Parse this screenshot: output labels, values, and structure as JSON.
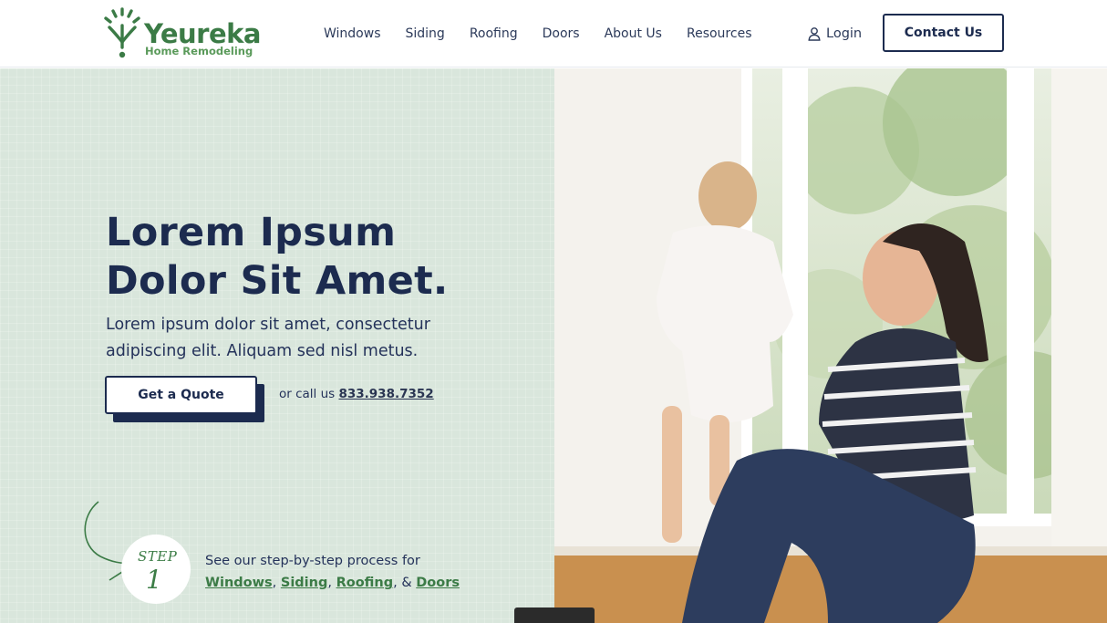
{
  "brand": {
    "name": "Yeureka",
    "tagline": "Home Remodeling",
    "color_primary": "#3b7b46",
    "color_navy": "#1c2b4f",
    "hero_bg": "#d9e6dc"
  },
  "nav": {
    "items": [
      {
        "label": "Windows"
      },
      {
        "label": "Siding"
      },
      {
        "label": "Roofing"
      },
      {
        "label": "Doors"
      },
      {
        "label": "About Us"
      },
      {
        "label": "Resources"
      }
    ],
    "login_label": "Login",
    "contact_label": "Contact Us"
  },
  "hero": {
    "headline_line1": "Lorem Ipsum",
    "headline_line2": "Dolor Sit Amet.",
    "subtext_line1": "Lorem ipsum dolor sit amet, consectetur",
    "subtext_line2": "adipiscing elit. Aliquam sed nisl metus.",
    "cta_label": "Get a Quote",
    "call_prefix": "or call us",
    "phone": "833.938.7352"
  },
  "step": {
    "label": "STEP",
    "number": "1",
    "intro": "See our step-by-step process for",
    "links": [
      {
        "label": "Windows"
      },
      {
        "label": "Siding"
      },
      {
        "label": "Roofing"
      },
      {
        "label": "Doors"
      }
    ],
    "sep1": ",",
    "sep2": ",",
    "sep3": ", &"
  }
}
